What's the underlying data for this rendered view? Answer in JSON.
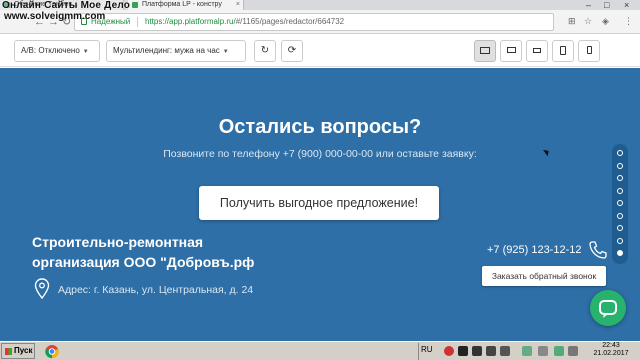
{
  "overlay": {
    "watermark_top": "Онлайн Сайты Мое Дело",
    "watermark_url": "www.solveigmm.com"
  },
  "browser": {
    "tabs": [
      {
        "label": "Обучение Тамбов..."
      },
      {
        "label": "Платформа LP - констру"
      }
    ],
    "secure_label": "Надежный",
    "url_host": "https://app.platformalp.ru/",
    "url_rest": "#/1165/pages/redactor/664732"
  },
  "toolbar": {
    "ab_select": "A/B: Отключено",
    "multilanding_select": "Мультилендинг: мужа на час",
    "devices": [
      "desktop-wide",
      "desktop",
      "laptop",
      "tablet",
      "mobile"
    ]
  },
  "page": {
    "heading": "Остались вопросы?",
    "subheading": "Позвоните по телефону +7 (900) 000-00-00 или оставьте заявку:",
    "cta_button": "Получить выгодное предложение!",
    "org_line1": "Строительно-ремонтная",
    "org_line2": "организация ООО \"Добровъ.рф",
    "address": "Адрес: г. Казань, ул. Центральная, д. 24",
    "phone": "+7 (925) 123-12-12",
    "callback_button": "Заказать обратный звонок",
    "section_dots": 9,
    "active_dot": 9,
    "colors": {
      "section_bg": "#2d6fa6",
      "chat_button": "#27b36d"
    }
  },
  "taskbar": {
    "start_label": "Пуск",
    "language": "RU",
    "time": "22:43",
    "date": "21.02.2017"
  }
}
